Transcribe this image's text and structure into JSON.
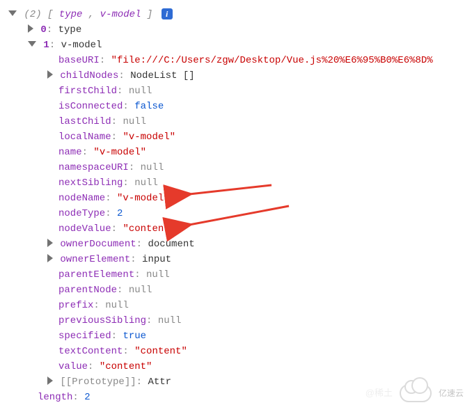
{
  "header": {
    "count_label": "(2)",
    "summary_open": "[",
    "summary_item0": "type",
    "summary_sep": ",",
    "summary_item1": "v-model",
    "summary_close": "]",
    "info_badge": "i"
  },
  "entry0": {
    "index": "0",
    "value": "type"
  },
  "entry1": {
    "index": "1",
    "value": "v-model"
  },
  "props": {
    "baseURI": {
      "k": "baseURI",
      "v": "\"file:///C:/Users/zgw/Desktop/Vue.js%20%E6%95%B0%E6%8D%"
    },
    "childNodes": {
      "k": "childNodes",
      "v": "NodeList []"
    },
    "firstChild": {
      "k": "firstChild",
      "v": "null"
    },
    "isConnected": {
      "k": "isConnected",
      "v": "false"
    },
    "lastChild": {
      "k": "lastChild",
      "v": "null"
    },
    "localName": {
      "k": "localName",
      "v": "\"v-model\""
    },
    "name": {
      "k": "name",
      "v": "\"v-model\""
    },
    "namespaceURI": {
      "k": "namespaceURI",
      "v": "null"
    },
    "nextSibling": {
      "k": "nextSibling",
      "v": "null"
    },
    "nodeName": {
      "k": "nodeName",
      "v": "\"v-model\""
    },
    "nodeType": {
      "k": "nodeType",
      "v": "2"
    },
    "nodeValue": {
      "k": "nodeValue",
      "v": "\"content\""
    },
    "ownerDocument": {
      "k": "ownerDocument",
      "v": "document"
    },
    "ownerElement": {
      "k": "ownerElement",
      "v": "input"
    },
    "parentElement": {
      "k": "parentElement",
      "v": "null"
    },
    "parentNode": {
      "k": "parentNode",
      "v": "null"
    },
    "prefix": {
      "k": "prefix",
      "v": "null"
    },
    "previousSibling": {
      "k": "previousSibling",
      "v": "null"
    },
    "specified": {
      "k": "specified",
      "v": "true"
    },
    "textContent": {
      "k": "textContent",
      "v": "\"content\""
    },
    "value": {
      "k": "value",
      "v": "\"content\""
    }
  },
  "proto": {
    "label": "[[Prototype]]",
    "value": "Attr"
  },
  "length": {
    "label": "length",
    "value": "2"
  },
  "watermark": {
    "left": "@稀土",
    "right": "亿速云"
  }
}
